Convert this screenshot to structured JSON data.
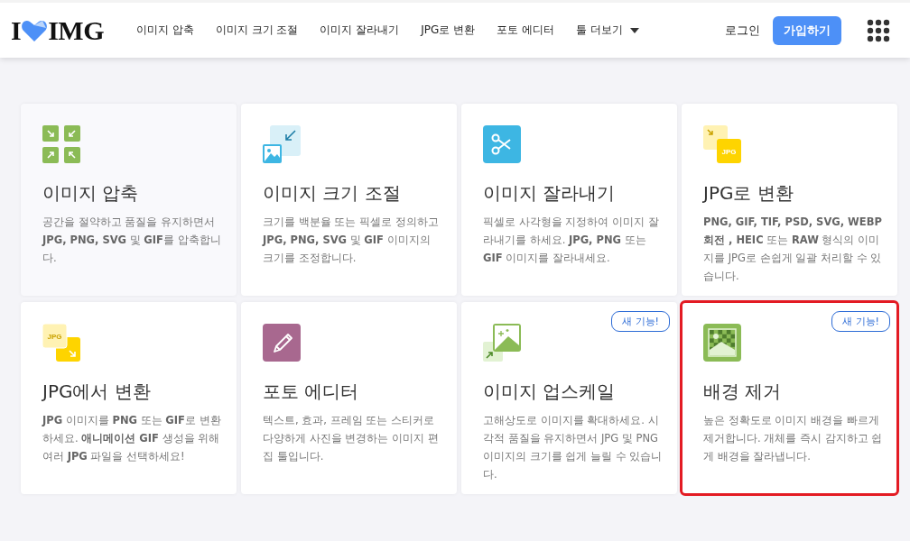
{
  "header": {
    "logo": {
      "left": "I",
      "right": "IMG"
    },
    "nav": [
      {
        "label": "이미지 압축"
      },
      {
        "label": "이미지 크기 조절"
      },
      {
        "label": "이미지 잘라내기"
      },
      {
        "label": "JPG로 변환"
      },
      {
        "label": "포토 에디터"
      },
      {
        "label": "툴 더보기",
        "dropdown": true
      }
    ],
    "login": "로그인",
    "signup": "가입하기"
  },
  "cards": [
    {
      "kind": "compress",
      "title": "이미지 압축",
      "description": "공간을 절약하고 품질을 유지하면서 **JPG, PNG, SVG** 및 **GIF**를 압축합니다.",
      "highlighted": false
    },
    {
      "kind": "resize",
      "title": "이미지 크기 조절",
      "description": "크기를 백분율 또는 픽셀로 정의하고 **JPG, PNG, SVG** 및 **GIF** 이미지의 크기를 조정합니다.",
      "highlighted": false
    },
    {
      "kind": "crop",
      "title": "이미지 잘라내기",
      "description": "픽셀로 사각형을 지정하여 이미지 잘라내기를 하세요. **JPG, PNG** 또는 **GIF** 이미지를 잘라내세요.",
      "highlighted": false
    },
    {
      "kind": "to-jpg",
      "icon_text": "JPG",
      "title": "JPG로 변환",
      "description": "**PNG, GIF, TIF, PSD, SVG, WEBP 회전 , HEIC** 또는 **RAW** 형식의 이미지를 JPG로 손쉽게 일괄 처리할 수 있습니다.",
      "highlighted": false
    },
    {
      "kind": "from-jpg",
      "icon_text": "JPG",
      "title": "JPG에서 변환",
      "description": "**JPG** 이미지를 **PNG** 또는 **GIF**로 변환하세요. **애니메이션 GIF** 생성을 위해 여러 **JPG** 파일을 선택하세요!",
      "highlighted": false
    },
    {
      "kind": "editor",
      "title": "포토 에디터",
      "description": "텍스트, 효과, 프레임 또는 스티커로 다양하게 사진을 변경하는 이미지 편집 툴입니다.",
      "highlighted": false
    },
    {
      "kind": "upscale",
      "badge": "새 기능!",
      "title": "이미지 업스케일",
      "description": "고해상도로 이미지를 확대하세요. 시각적 품질을 유지하면서 JPG 및 PNG 이미지의 크기를 쉽게 늘릴 수 있습니다.",
      "highlighted": false
    },
    {
      "kind": "remove-bg",
      "badge": "새 기능!",
      "title": "배경 제거",
      "description": "높은 정확도로 이미지 배경을 빠르게 제거합니다. 개체를 즉시 감지하고 쉽게 배경을 잘라냅니다.",
      "highlighted": true
    }
  ]
}
